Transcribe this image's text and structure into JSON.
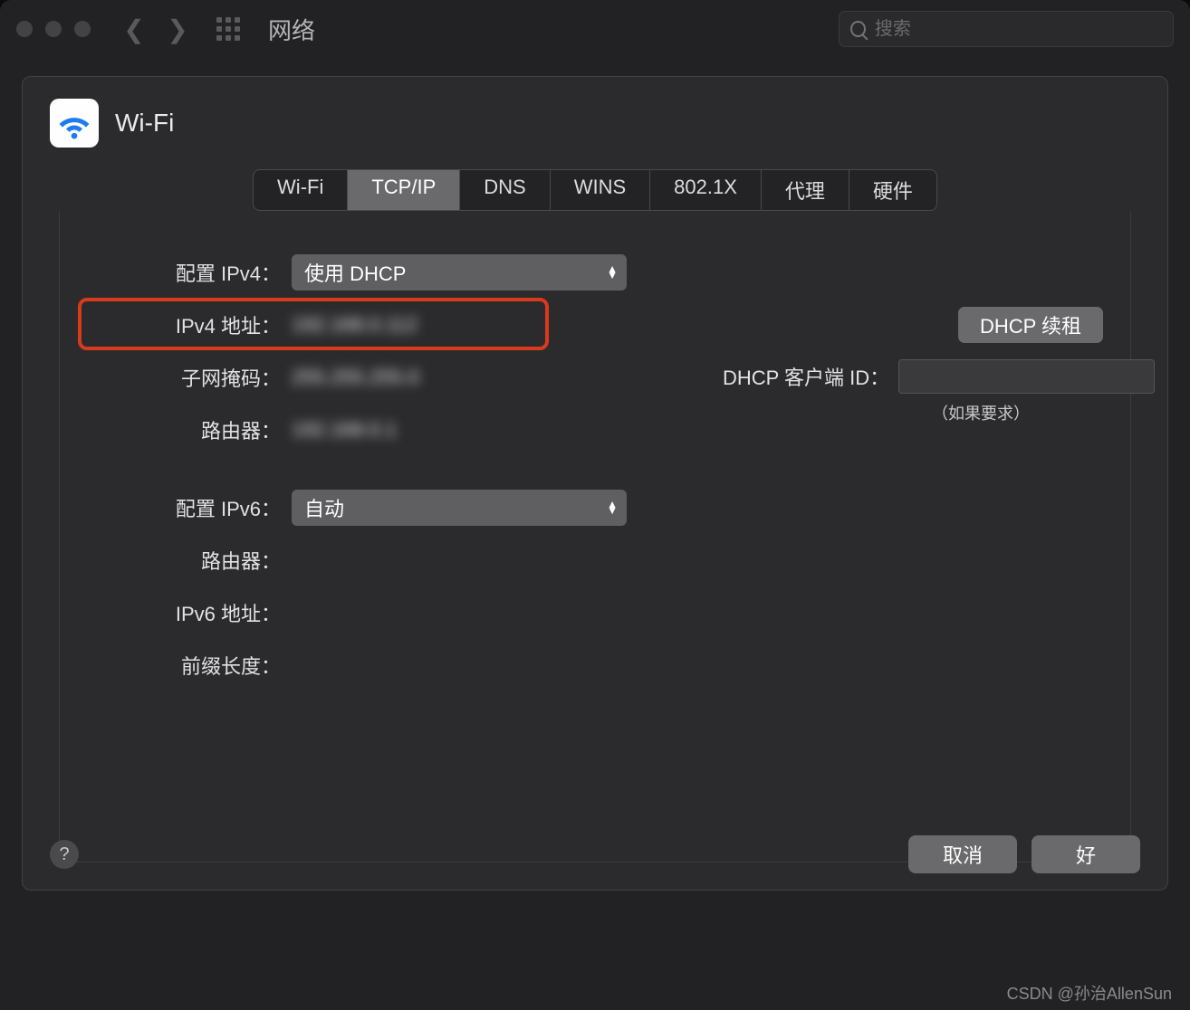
{
  "titlebar": {
    "title": "网络",
    "search_placeholder": "搜索"
  },
  "sheet": {
    "title": "Wi-Fi"
  },
  "tabs": [
    "Wi-Fi",
    "TCP/IP",
    "DNS",
    "WINS",
    "802.1X",
    "代理",
    "硬件"
  ],
  "active_tab": 1,
  "form": {
    "ipv4_config_label": "配置 IPv4：",
    "ipv4_config_value": "使用 DHCP",
    "ipv4_addr_label": "IPv4 地址：",
    "ipv4_addr_value": "192.168.0.112",
    "subnet_label": "子网掩码：",
    "subnet_value": "255.255.255.0",
    "router_label": "路由器：",
    "router_value": "192.168.0.1",
    "ipv6_config_label": "配置 IPv6：",
    "ipv6_config_value": "自动",
    "router6_label": "路由器：",
    "ipv6_addr_label": "IPv6 地址：",
    "prefix_label": "前缀长度："
  },
  "right": {
    "dhcp_renew": "DHCP 续租",
    "dhcp_client_id_label": "DHCP 客户端 ID：",
    "dhcp_hint": "（如果要求）"
  },
  "footer": {
    "cancel": "取消",
    "ok": "好"
  },
  "watermark": "CSDN @孙治AllenSun"
}
